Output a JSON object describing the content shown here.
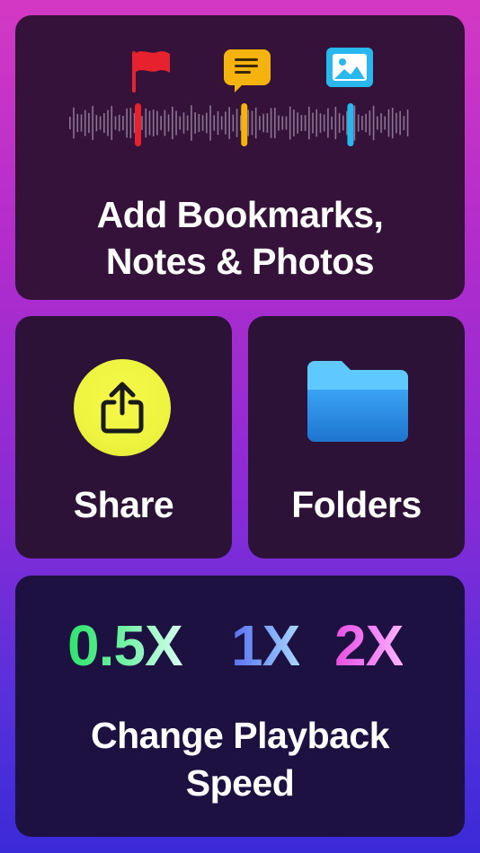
{
  "top_card": {
    "title_line1": "Add Bookmarks,",
    "title_line2": "Notes & Photos",
    "marker_icons": [
      "flag-icon",
      "note-icon",
      "photo-icon"
    ],
    "marker_colors": [
      "#e8212f",
      "#f7b30d",
      "#29b8ee"
    ]
  },
  "share_card": {
    "label": "Share",
    "icon": "share-icon",
    "icon_color": "#eef43f"
  },
  "folders_card": {
    "label": "Folders",
    "icon": "folder-icon",
    "icon_color": "#2e8de6"
  },
  "speed_card": {
    "speeds": [
      "0.5X",
      "1X",
      "2X"
    ],
    "title_line1": "Change Playback",
    "title_line2": "Speed"
  }
}
